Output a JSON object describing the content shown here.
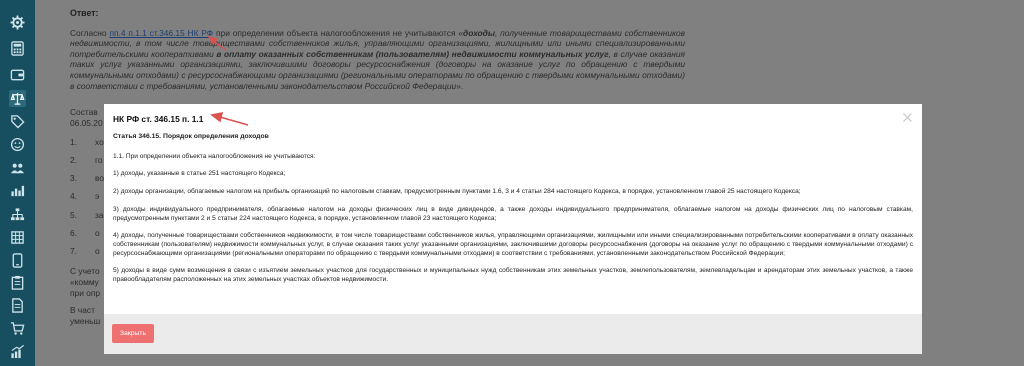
{
  "sidebar": {
    "icons": [
      "gear-icon",
      "calculator-icon",
      "wallet-icon",
      "scales-icon",
      "tag-icon",
      "smiley-icon",
      "people-icon",
      "bar-chart-icon",
      "hierarchy-icon",
      "grid-icon",
      "phone-icon",
      "clipboard-icon",
      "document-icon",
      "cart-icon",
      "growth-chart-icon"
    ],
    "bg": "#174f60"
  },
  "document": {
    "answer_title": "Ответ:",
    "para1_pre": "Согласно ",
    "para1_link": "пп.4 п.1.1 ст.346.15 НК РФ",
    "para1_mid": " при определении объекта налогообложения не учитываются «",
    "para1_bold1": "доходы",
    "para1_italic1": ", полученные товариществами собственников недвижимости, в том числе товариществами собственников жилья, управляющими организациями, жилищными или иными специализированными потребительскими кооперативами ",
    "para1_bold2": "в оплату оказанных собственникам (пользователям) недвижимости коммунальных услуг",
    "para1_italic2": ", в случае оказания таких услуг указанными организациями, заключившими договоры ресурсоснабжения (договоры на оказание услуг по обращению с твердыми коммунальными отходами) с ресурсоснабжающими организациями (региональными операторами по обращению с твердыми коммунальными отходами) в соответствии с требованиями, установленными законодательством Российской Федерации",
    "para1_end": "».",
    "stub_lines": [
      "Состав",
      "06.05.20"
    ],
    "list_numbers": [
      "1.",
      "2.",
      "3.",
      "4.",
      "5.",
      "6.",
      "7."
    ],
    "list_stubs": [
      "хо",
      "го",
      "во",
      "э",
      "за",
      "о",
      "о"
    ],
    "stub_bottom": [
      "С учето",
      "«комму",
      "при опр",
      "В част",
      "уменьш"
    ]
  },
  "modal": {
    "title": "НК РФ ст. 346.15 п. 1.1",
    "article": "Статья 346.15. Порядок определения доходов",
    "paragraphs": [
      "1.1. При определении объекта налогообложения не учитываются:",
      "1) доходы, указанные в статье 251 настоящего Кодекса;",
      "2) доходы организации, облагаемые налогом на прибыль организаций по налоговым ставкам, предусмотренным пунктами 1.6, 3 и 4 статьи 284 настоящего Кодекса, в порядке, установленном главой 25 настоящего Кодекса;",
      "3) доходы индивидуального предпринимателя, облагаемые налогом на доходы физических лиц в виде дивидендов, а также доходы индивидуального предпринимателя, облагаемые налогом на доходы физических лиц по налоговым ставкам, предусмотренным пунктами 2 и 5 статьи 224 настоящего Кодекса, в порядке, установленном главой 23 настоящего Кодекса;",
      "4) доходы, полученные товариществами собственников недвижимости, в том числе товариществами собственников жилья, управляющими организациями, жилищными или иными специализированными потребительскими кооперативами в оплату оказанных собственникам (пользователям) недвижимости коммунальных услуг, в случае оказания таких услуг указанными организациями, заключившими договоры ресурсоснабжения (договоры на оказание услуг по обращению с твердыми коммунальными отходами) с ресурсоснабжающими организациями (региональными операторами по обращению с твердыми коммунальными отходами) в соответствии с требованиями, установленными законодательством Российской Федерации;",
      "5) доходы в виде сумм возмещения в связи с изъятием земельных участков для государственных и муниципальных нужд собственникам этих земельных участков, землепользователям, землевладельцам и арендаторам этих земельных участков, а также правообладателям расположенных на этих земельных участках объектов недвижимости."
    ],
    "close_button": "Закрыть",
    "close_icon": "close-icon",
    "accent": "#ee7070",
    "arrow_color": "#d9534f"
  }
}
